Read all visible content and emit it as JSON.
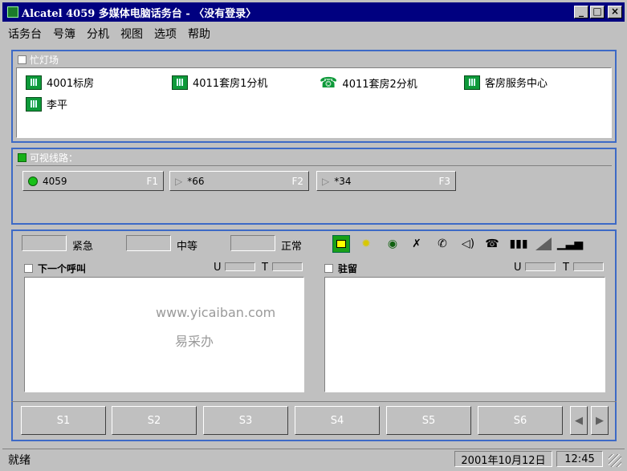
{
  "window": {
    "title": "Alcatel 4059 多媒体电脑话务台 - 〈没有登录〉",
    "min": "_",
    "max": "□",
    "close": "×"
  },
  "menu": [
    "话务台",
    "号簿",
    "分机",
    "视图",
    "选项",
    "帮助"
  ],
  "lamp_panel": {
    "title": "忙灯场",
    "items": [
      "4001标房",
      "4011套房1分机",
      "4011套房2分机",
      "客房服务中心",
      "李平"
    ]
  },
  "trunk_panel": {
    "title": "可视线路：",
    "lines": [
      {
        "label": "4059",
        "key": "F1"
      },
      {
        "label": "*66",
        "key": "F2"
      },
      {
        "label": "*34",
        "key": "F3"
      }
    ]
  },
  "queues": {
    "urgent": "紧急",
    "medium": "中等",
    "normal": "正常"
  },
  "toolbar_icons": [
    "terminal-icon",
    "sun-icon",
    "eye-icon",
    "pickup-icon",
    "handset-icon",
    "speaker-icon",
    "phone-icon",
    "group-icon",
    "volume-icon",
    "signal-icon"
  ],
  "next_call": {
    "title": "下一个呼叫",
    "u": "U",
    "t": "T"
  },
  "parked": {
    "title": "驻留",
    "u": "U",
    "t": "T"
  },
  "watermark": {
    "url": "www.yicaiban.com",
    "name": "易采办"
  },
  "slots": [
    "S1",
    "S2",
    "S3",
    "S4",
    "S5",
    "S6"
  ],
  "status": {
    "text": "就绪",
    "date": "2001年10月12日",
    "time": "12:45"
  }
}
